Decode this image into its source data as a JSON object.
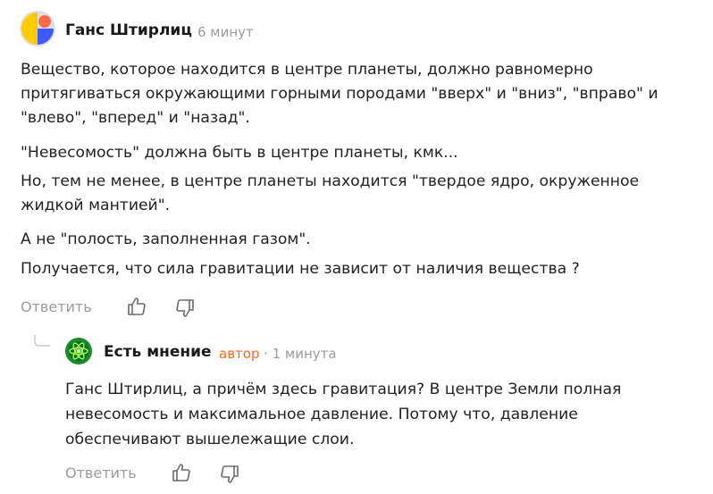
{
  "comment": {
    "author": "Ганс Штирлиц",
    "time": "6 минут",
    "paragraphs": [
      [
        "Вещество, которое находится в центре планеты, должно равномерно",
        "притягиваться окружающими горными породами \"вверх\" и \"вниз\", \"вправо\" и",
        "\"влево\", \"вперед\" и \"назад\"."
      ],
      [
        "\"Невесомость\" должна быть в центре планеты, кмк..."
      ],
      [
        "Но, тем не менее, в центре планеты находится \"твердое ядро, окруженное",
        "жидкой мантией\"."
      ],
      [
        "А не \"полость, заполненная газом\"."
      ],
      [
        "Получается, что сила гравитации не зависит от наличия вещества ?"
      ]
    ],
    "reply_label": "Ответить",
    "like_icon": "thumbs-up-icon",
    "dislike_icon": "thumbs-down-icon",
    "avatar_colors": [
      "#ffcc00",
      "#3d5afe",
      "#ff6b4a",
      "#e0e0e0"
    ]
  },
  "reply": {
    "author": "Есть мнение",
    "badge": "автор",
    "separator": "·",
    "time": "1 минута",
    "lines": [
      "Ганс Штирлиц, а причём здесь гравитация? В центре Земли полная",
      "невесомость и максимальное давление. Потому что, давление",
      "обеспечивают вышележащие слои."
    ],
    "reply_label": "Ответить",
    "like_icon": "thumbs-up-icon",
    "dislike_icon": "thumbs-down-icon",
    "avatar_colors": [
      "#1b8a2a",
      "#9bff5a"
    ]
  }
}
